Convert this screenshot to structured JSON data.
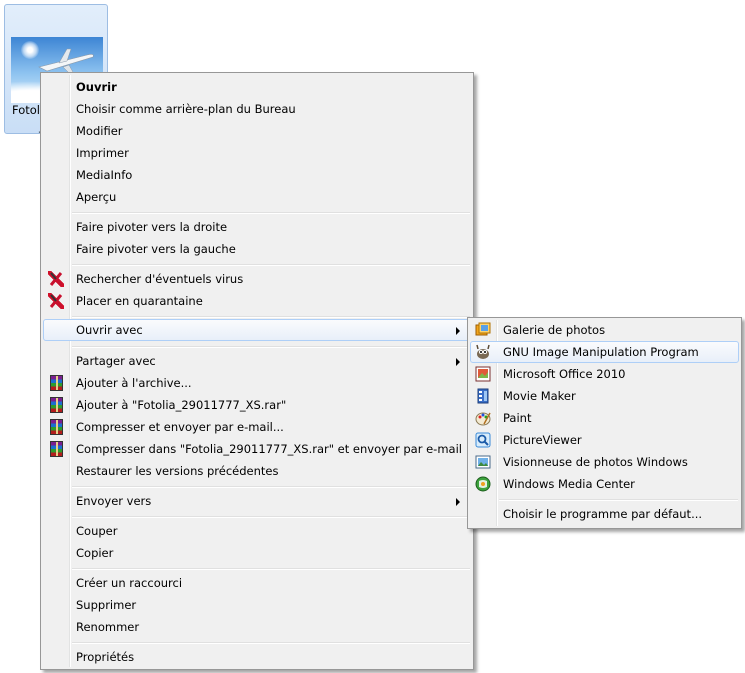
{
  "desktop_icon": {
    "label_line1": "Fotol",
    "label_line2": "_"
  },
  "context_menu": {
    "items": [
      {
        "label": "Ouvrir"
      },
      {
        "label": "Choisir comme arrière-plan du Bureau"
      },
      {
        "label": "Modifier"
      },
      {
        "label": "Imprimer"
      },
      {
        "label": "MediaInfo"
      },
      {
        "label": "Aperçu"
      },
      {
        "label": "Faire pivoter vers la droite"
      },
      {
        "label": "Faire pivoter vers la gauche"
      },
      {
        "label": "Rechercher d'éventuels virus",
        "icon": "kaspersky-icon"
      },
      {
        "label": "Placer en quarantaine",
        "icon": "kaspersky-icon"
      },
      {
        "label": "Ouvrir avec"
      },
      {
        "label": "Partager avec"
      },
      {
        "label": "Ajouter à l'archive...",
        "icon": "winrar-icon"
      },
      {
        "label": "Ajouter à \"Fotolia_29011777_XS.rar\"",
        "icon": "winrar-icon"
      },
      {
        "label": "Compresser et envoyer par e-mail...",
        "icon": "winrar-icon"
      },
      {
        "label": "Compresser dans \"Fotolia_29011777_XS.rar\" et envoyer par e-mail",
        "icon": "winrar-icon"
      },
      {
        "label": "Restaurer les versions précédentes"
      },
      {
        "label": "Envoyer vers"
      },
      {
        "label": "Couper"
      },
      {
        "label": "Copier"
      },
      {
        "label": "Créer un raccourci"
      },
      {
        "label": "Supprimer"
      },
      {
        "label": "Renommer"
      },
      {
        "label": "Propriétés"
      }
    ]
  },
  "open_with_submenu": {
    "items": [
      {
        "label": "Galerie de photos",
        "icon": "photo-gallery-icon"
      },
      {
        "label": "GNU Image Manipulation Program",
        "icon": "gimp-icon"
      },
      {
        "label": "Microsoft Office 2010",
        "icon": "office-picture-manager-icon"
      },
      {
        "label": "Movie Maker",
        "icon": "movie-maker-icon"
      },
      {
        "label": "Paint",
        "icon": "paint-icon"
      },
      {
        "label": "PictureViewer",
        "icon": "picture-viewer-icon"
      },
      {
        "label": "Visionneuse de photos Windows",
        "icon": "windows-photo-viewer-icon"
      },
      {
        "label": "Windows Media Center",
        "icon": "media-center-icon"
      },
      {
        "label": "Choisir le programme par défaut..."
      }
    ]
  },
  "colors": {
    "menu_bg": "#f0f0f0",
    "highlight_border": "#aecff7",
    "selection_bg": "#cbdff6"
  }
}
